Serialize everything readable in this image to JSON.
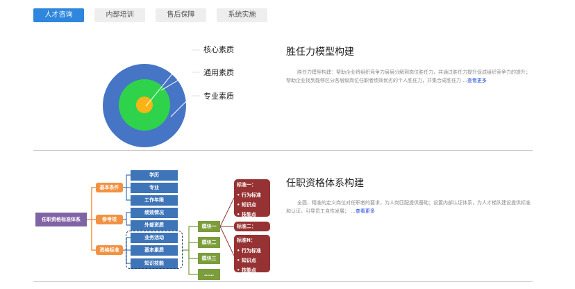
{
  "tabs": [
    "人才咨询",
    "内部培训",
    "售后保障",
    "系统实施"
  ],
  "section1": {
    "title": "胜任力模型构建",
    "desc": "胜任力模型构建：帮助企业将组织竞争力层层分解到岗位胜任力，并通过胜任力提升促成组织竞争力的提升；帮助企业找到能够区分各层级岗位任职者绩效优劣的个人胜任力，并集合成胜任力 ...",
    "more": "查看更多",
    "rings": [
      "核心素质",
      "通用素质",
      "专业素质"
    ],
    "colors": {
      "outer": "#4675c5",
      "middle": "#2ed34b",
      "inner": "#f8b417"
    }
  },
  "section2": {
    "title": "任职资格体系构建",
    "desc": "全面、精准的定义岗位对任职者的要求，为人岗匹配提供基础；设置内部认证体系，为人才梯队建设提供标准和认证，引导员工自性发展； ...",
    "more": "查看更多",
    "root": "任职资格标准体系",
    "categories": [
      "基本条件",
      "参考项",
      "资格标准"
    ],
    "leaves": [
      "学历",
      "专业",
      "工作年限",
      "绩效情况",
      "外部资质",
      "业务活动",
      "基本素质",
      "知识技能"
    ],
    "modules": [
      "模块一",
      "模块二",
      "模块三",
      "……"
    ],
    "standards": [
      {
        "title": "标准一：",
        "items": [
          "行为标准",
          "知识点",
          "技能点"
        ]
      },
      {
        "title": "标准二：",
        "items": []
      },
      {
        "title": "标准N：",
        "items": [
          "行为标准",
          "知识点",
          "技能点"
        ]
      }
    ],
    "colors": {
      "root": "#8063a5",
      "category": "#f29141",
      "leaf": "#3e74b8",
      "module": "#7b9d3b",
      "standard": "#963233"
    }
  }
}
